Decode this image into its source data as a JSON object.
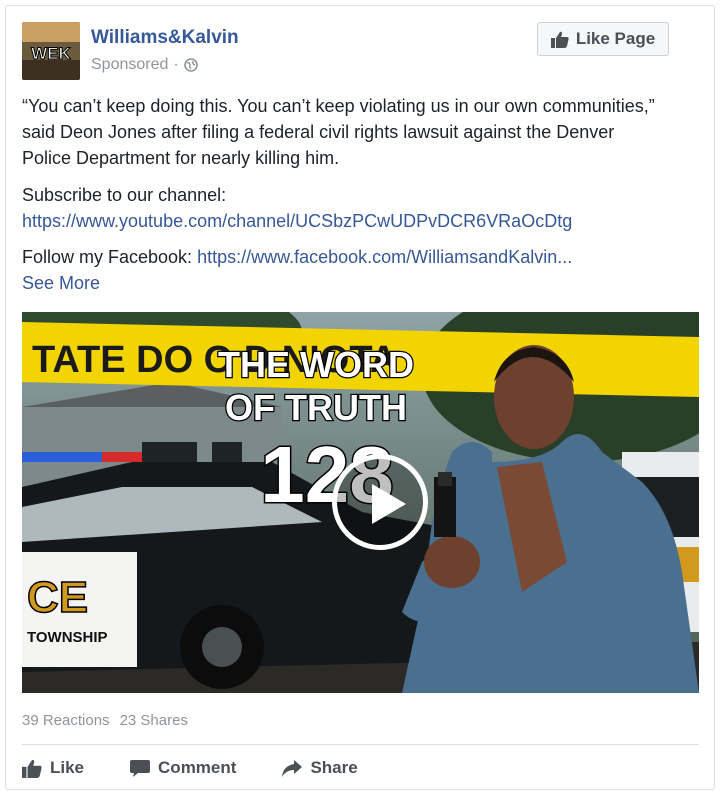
{
  "post": {
    "page_name": "Williams&Kalvin",
    "avatar_text": "WEK",
    "sponsored": "Sponsored",
    "separator": "·",
    "like_page_label": "Like Page",
    "body": {
      "quote": "“You can’t keep doing this. You can’t keep violating us in our own communities,” said Deon Jones after filing a federal civil rights lawsuit against the Denver Police Department for nearly killing him.",
      "subscribe_label": "Subscribe to our channel:",
      "subscribe_link": "https://www.youtube.com/channel/UCSbzPCwUDPvDCR6VRaOcDtg",
      "follow_label": "Follow my Facebook:",
      "follow_link": "https://www.facebook.com/WilliamsandKalvin...",
      "see_more": "See More"
    },
    "media": {
      "title_line1": "THE WORD",
      "title_line2": "OF TRUTH",
      "episode": "128",
      "car_text_1": "CE",
      "car_text_2": "TOWNSHIP",
      "tape_text": "TATE DO  O  D  NIOTA"
    },
    "stats": {
      "reactions": "39 Reactions",
      "shares": "23 Shares"
    },
    "actions": {
      "like": "Like",
      "comment": "Comment",
      "share": "Share"
    }
  },
  "colors": {
    "link": "#365899",
    "muted": "#90949c",
    "text": "#1d2129",
    "tape": "#f2d400"
  }
}
